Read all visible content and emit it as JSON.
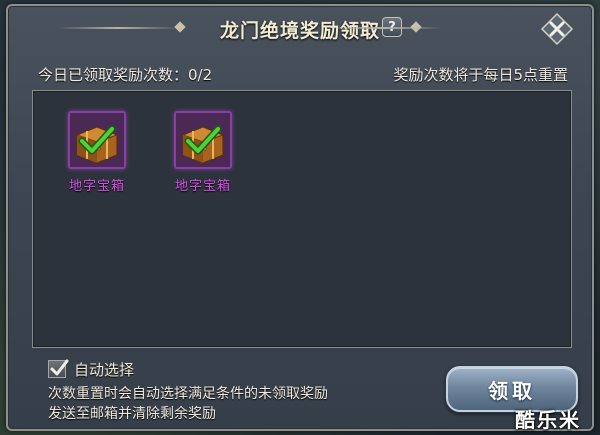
{
  "dialog": {
    "title": "龙门绝境奖励领取",
    "help_label": "?"
  },
  "info": {
    "claimed_count_text": "今日已领取奖励次数：0/2",
    "reset_notice": "奖励次数将于每日5点重置"
  },
  "rewards": [
    {
      "name": "地字宝箱",
      "icon": "treasure-chest-icon",
      "checked": true
    },
    {
      "name": "地字宝箱",
      "icon": "treasure-chest-icon",
      "checked": true
    }
  ],
  "auto_select": {
    "label": "自动选择",
    "checked": true
  },
  "description": {
    "line1": "次数重置时会自动选择满足条件的未领取奖励",
    "line2": "发送至邮箱并清除剩余奖励"
  },
  "claim_button": {
    "label": "领取"
  },
  "watermark": "酷乐米",
  "colors": {
    "item_name": "#d84fe8",
    "item_frame": "#8a3fa7",
    "check_green": "#4fd13a",
    "button_blue": "#6f869e"
  }
}
